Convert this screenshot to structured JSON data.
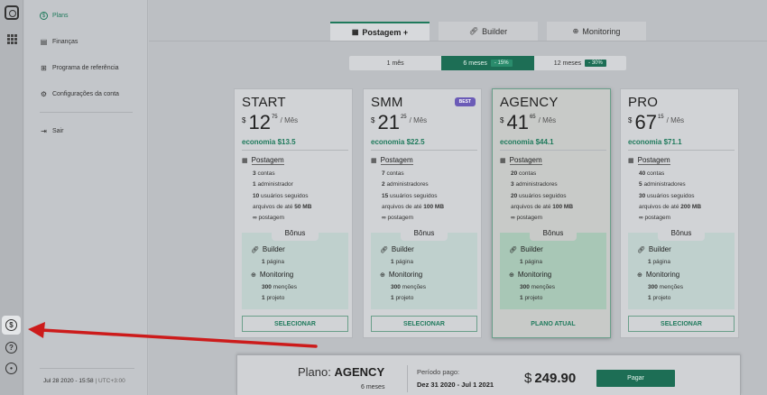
{
  "sidebar": {
    "items": [
      {
        "label": "Plans",
        "icon": "dollar-circle-icon"
      },
      {
        "label": "Finanças",
        "icon": "document-icon"
      },
      {
        "label": "Programa de referência",
        "icon": "gift-icon"
      },
      {
        "label": "Configurações da conta",
        "icon": "gear-icon"
      },
      {
        "label": "Sair",
        "icon": "logout-icon"
      }
    ],
    "footer": {
      "datetime": "Jul 28 2020 - 15:58",
      "timezone": "UTC+3:00"
    }
  },
  "tabs": [
    {
      "label": "Postagem +",
      "icon": "calendar-icon"
    },
    {
      "label": "Builder",
      "icon": "link-icon"
    },
    {
      "label": "Monitoring",
      "icon": "globe-icon"
    }
  ],
  "periods": [
    {
      "label": "1 mês",
      "discount": ""
    },
    {
      "label": "6 meses",
      "discount": "- 15%"
    },
    {
      "label": "12 meses",
      "discount": "- 30%"
    }
  ],
  "plans": [
    {
      "name": "START",
      "badge": "",
      "currency": "$",
      "price_int": "12",
      "price_dec": "75",
      "period": "/ Mês",
      "savings": "economia $13.5",
      "section": "Postagem",
      "lines": [
        {
          "b": "3",
          "t": "contas"
        },
        {
          "b": "1",
          "t": "administrador"
        },
        {
          "b": "10",
          "t": "usuários seguidos"
        },
        {
          "b": "",
          "t": "arquivos de até",
          "b2": "50 MB"
        },
        {
          "b": "∞",
          "t": "postagem"
        }
      ],
      "bonus": "Bônus",
      "builder": "Builder",
      "builder_sub_b": "1",
      "builder_sub": "página",
      "monitoring": "Monitoring",
      "mon1_b": "300",
      "mon1": "menções",
      "mon2_b": "1",
      "mon2": "projeto",
      "button": "SELECIONAR"
    },
    {
      "name": "SMM",
      "badge": "BEST",
      "currency": "$",
      "price_int": "21",
      "price_dec": "25",
      "period": "/ Mês",
      "savings": "economia $22.5",
      "section": "Postagem",
      "lines": [
        {
          "b": "7",
          "t": "contas"
        },
        {
          "b": "2",
          "t": "administradores"
        },
        {
          "b": "15",
          "t": "usuários seguidos"
        },
        {
          "b": "",
          "t": "arquivos de até",
          "b2": "100 MB"
        },
        {
          "b": "∞",
          "t": "postagem"
        }
      ],
      "bonus": "Bônus",
      "builder": "Builder",
      "builder_sub_b": "1",
      "builder_sub": "página",
      "monitoring": "Monitoring",
      "mon1_b": "300",
      "mon1": "menções",
      "mon2_b": "1",
      "mon2": "projeto",
      "button": "SELECIONAR"
    },
    {
      "name": "AGENCY",
      "badge": "",
      "currency": "$",
      "price_int": "41",
      "price_dec": "65",
      "period": "/ Mês",
      "savings": "economia $44.1",
      "section": "Postagem",
      "lines": [
        {
          "b": "20",
          "t": "contas"
        },
        {
          "b": "3",
          "t": "administradores"
        },
        {
          "b": "20",
          "t": "usuários seguidos"
        },
        {
          "b": "",
          "t": "arquivos de até",
          "b2": "100 MB"
        },
        {
          "b": "∞",
          "t": "postagem"
        }
      ],
      "bonus": "Bônus",
      "builder": "Builder",
      "builder_sub_b": "1",
      "builder_sub": "página",
      "monitoring": "Monitoring",
      "mon1_b": "300",
      "mon1": "menções",
      "mon2_b": "1",
      "mon2": "projeto",
      "button": "PLANO ATUAL"
    },
    {
      "name": "PRO",
      "badge": "",
      "currency": "$",
      "price_int": "67",
      "price_dec": "15",
      "period": "/ Mês",
      "savings": "economia $71.1",
      "section": "Postagem",
      "lines": [
        {
          "b": "40",
          "t": "contas"
        },
        {
          "b": "5",
          "t": "administradores"
        },
        {
          "b": "30",
          "t": "usuários seguidos"
        },
        {
          "b": "",
          "t": "arquivos de até",
          "b2": "200 MB"
        },
        {
          "b": "∞",
          "t": "postagem"
        }
      ],
      "bonus": "Bônus",
      "builder": "Builder",
      "builder_sub_b": "1",
      "builder_sub": "página",
      "monitoring": "Monitoring",
      "mon1_b": "300",
      "mon1": "menções",
      "mon2_b": "1",
      "mon2": "projeto",
      "button": "SELECIONAR"
    }
  ],
  "summary": {
    "plan_label": "Plano:",
    "plan_name": "AGENCY",
    "months": "6 meses",
    "paid_period_label": "Período pago:",
    "paid_period": "Dez 31 2020 - Jul 1 2021",
    "currency": "$",
    "total": "249.90",
    "pay_button": "Pagar"
  },
  "colors": {
    "accent": "#1f7a5c",
    "badge": "#6b5bb7",
    "annotation_arrow": "#cc1b1b"
  }
}
